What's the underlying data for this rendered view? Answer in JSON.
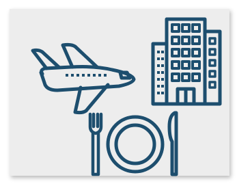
{
  "colors": {
    "ink": "#1d4e6e",
    "card_background": "#ededed",
    "page_background": "#ffffff"
  },
  "icons": [
    "airplane-icon",
    "hotel-building-icon",
    "plate-fork-knife-icon"
  ]
}
